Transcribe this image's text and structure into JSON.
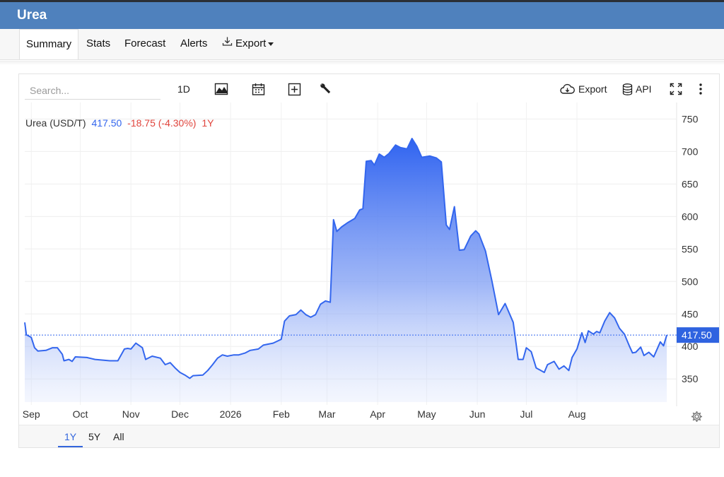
{
  "app": {
    "title": "Urea"
  },
  "tabs": [
    {
      "label": "Summary"
    },
    {
      "label": "Stats"
    },
    {
      "label": "Forecast"
    },
    {
      "label": "Alerts"
    },
    {
      "label": "Export"
    }
  ],
  "toolbar": {
    "search_placeholder": "Search...",
    "interval_label": "1D",
    "export_label": "Export",
    "api_label": "API"
  },
  "icons": [
    "chart-type-icon",
    "calendar-icon",
    "add-compare-icon",
    "wrench-icon",
    "cloud-download-icon",
    "database-icon",
    "fullscreen-icon",
    "more-vertical-icon",
    "settings-gear-icon",
    "download-icon"
  ],
  "colors": {
    "header": "#4f81bd",
    "line": "#3366ee",
    "negative": "#e0443c",
    "price_tag": "#2f63e0"
  },
  "legend": {
    "name": "Urea (USD/T)",
    "price": "417.50",
    "change": "-18.75 (-4.30%)",
    "period": "1Y"
  },
  "ranges": [
    {
      "label": "1Y",
      "active": true
    },
    {
      "label": "5Y",
      "active": false
    },
    {
      "label": "All",
      "active": false
    }
  ],
  "chart_data": {
    "type": "area",
    "title": "",
    "xlabel": "",
    "ylabel": "",
    "series": [
      {
        "name": "Urea (USD/T)",
        "points": [
          [
            "2025-08-28",
            437
          ],
          [
            "2025-08-29",
            418
          ],
          [
            "2025-09-01",
            414
          ],
          [
            "2025-09-03",
            398
          ],
          [
            "2025-09-05",
            393
          ],
          [
            "2025-09-10",
            394
          ],
          [
            "2025-09-14",
            398
          ],
          [
            "2025-09-17",
            398
          ],
          [
            "2025-09-20",
            388
          ],
          [
            "2025-09-21",
            378
          ],
          [
            "2025-09-24",
            380
          ],
          [
            "2025-09-26",
            377
          ],
          [
            "2025-09-28",
            384
          ],
          [
            "2025-10-05",
            383
          ],
          [
            "2025-10-10",
            380
          ],
          [
            "2025-10-19",
            378
          ],
          [
            "2025-10-24",
            378
          ],
          [
            "2025-10-28",
            396
          ],
          [
            "2025-10-30",
            397
          ],
          [
            "2025-11-01",
            396
          ],
          [
            "2025-11-04",
            405
          ],
          [
            "2025-11-08",
            398
          ],
          [
            "2025-11-10",
            380
          ],
          [
            "2025-11-14",
            385
          ],
          [
            "2025-11-19",
            382
          ],
          [
            "2025-11-22",
            372
          ],
          [
            "2025-11-25",
            375
          ],
          [
            "2025-11-28",
            367
          ],
          [
            "2025-12-01",
            360
          ],
          [
            "2025-12-04",
            356
          ],
          [
            "2025-12-07",
            351
          ],
          [
            "2025-12-09",
            355
          ],
          [
            "2025-12-15",
            356
          ],
          [
            "2025-12-18",
            363
          ],
          [
            "2025-12-21",
            372
          ],
          [
            "2025-12-24",
            382
          ],
          [
            "2025-12-27",
            387
          ],
          [
            "2025-12-30",
            385
          ],
          [
            "2026-01-03",
            387
          ],
          [
            "2026-01-06",
            387
          ],
          [
            "2026-01-10",
            390
          ],
          [
            "2026-01-13",
            394
          ],
          [
            "2026-01-18",
            396
          ],
          [
            "2026-01-21",
            402
          ],
          [
            "2026-01-27",
            405
          ],
          [
            "2026-02-01",
            411
          ],
          [
            "2026-02-03",
            439
          ],
          [
            "2026-02-06",
            447
          ],
          [
            "2026-02-10",
            449
          ],
          [
            "2026-02-13",
            456
          ],
          [
            "2026-02-16",
            449
          ],
          [
            "2026-02-19",
            445
          ],
          [
            "2026-02-22",
            449
          ],
          [
            "2026-02-25",
            465
          ],
          [
            "2026-02-28",
            470
          ],
          [
            "2026-03-03",
            468
          ],
          [
            "2026-03-05",
            595
          ],
          [
            "2026-03-07",
            577
          ],
          [
            "2026-03-10",
            584
          ],
          [
            "2026-03-14",
            591
          ],
          [
            "2026-03-18",
            597
          ],
          [
            "2026-03-21",
            610
          ],
          [
            "2026-03-23",
            612
          ],
          [
            "2026-03-25",
            685
          ],
          [
            "2026-03-28",
            686
          ],
          [
            "2026-03-30",
            679
          ],
          [
            "2026-04-02",
            696
          ],
          [
            "2026-04-05",
            691
          ],
          [
            "2026-04-08",
            697
          ],
          [
            "2026-04-12",
            710
          ],
          [
            "2026-04-15",
            706
          ],
          [
            "2026-04-19",
            704
          ],
          [
            "2026-04-22",
            720
          ],
          [
            "2026-04-25",
            708
          ],
          [
            "2026-04-28",
            691
          ],
          [
            "2026-05-03",
            693
          ],
          [
            "2026-05-07",
            690
          ],
          [
            "2026-05-10",
            684
          ],
          [
            "2026-05-13",
            587
          ],
          [
            "2026-05-15",
            580
          ],
          [
            "2026-05-18",
            615
          ],
          [
            "2026-05-21",
            548
          ],
          [
            "2026-05-24",
            549
          ],
          [
            "2026-05-28",
            570
          ],
          [
            "2026-05-31",
            578
          ],
          [
            "2026-06-02",
            573
          ],
          [
            "2026-06-06",
            547
          ],
          [
            "2026-06-10",
            500
          ],
          [
            "2026-06-14",
            449
          ],
          [
            "2026-06-18",
            466
          ],
          [
            "2026-06-23",
            437
          ],
          [
            "2026-06-26",
            380
          ],
          [
            "2026-06-29",
            380
          ],
          [
            "2026-07-01",
            398
          ],
          [
            "2026-07-04",
            392
          ],
          [
            "2026-07-07",
            367
          ],
          [
            "2026-07-12",
            360
          ],
          [
            "2026-07-14",
            372
          ],
          [
            "2026-07-18",
            377
          ],
          [
            "2026-07-21",
            365
          ],
          [
            "2026-07-24",
            370
          ],
          [
            "2026-07-27",
            363
          ],
          [
            "2026-07-29",
            383
          ],
          [
            "2026-08-01",
            396
          ],
          [
            "2026-08-04",
            421
          ],
          [
            "2026-08-06",
            406
          ],
          [
            "2026-08-08",
            424
          ],
          [
            "2026-08-11",
            419
          ],
          [
            "2026-08-13",
            423
          ],
          [
            "2026-08-15",
            421
          ],
          [
            "2026-08-18",
            439
          ],
          [
            "2026-08-21",
            452
          ],
          [
            "2026-08-24",
            444
          ],
          [
            "2026-08-27",
            428
          ],
          [
            "2026-08-30",
            419
          ],
          [
            "2026-09-02",
            401
          ],
          [
            "2026-09-04",
            390
          ],
          [
            "2026-09-06",
            391
          ],
          [
            "2026-09-09",
            399
          ],
          [
            "2026-09-11",
            386
          ],
          [
            "2026-09-14",
            391
          ],
          [
            "2026-09-17",
            384
          ],
          [
            "2026-09-21",
            407
          ],
          [
            "2026-09-23",
            401
          ],
          [
            "2026-09-25",
            417.5
          ]
        ]
      }
    ],
    "x_ticks": [
      {
        "label": "Sep",
        "date": "2025-09-01"
      },
      {
        "label": "Oct",
        "date": "2025-10-01"
      },
      {
        "label": "Nov",
        "date": "2025-11-01"
      },
      {
        "label": "Dec",
        "date": "2025-12-01"
      },
      {
        "label": "2026",
        "date": "2026-01-01"
      },
      {
        "label": "Feb",
        "date": "2026-02-01"
      },
      {
        "label": "Mar",
        "date": "2026-03-01"
      },
      {
        "label": "Apr",
        "date": "2026-04-01"
      },
      {
        "label": "May",
        "date": "2026-05-01"
      },
      {
        "label": "Jun",
        "date": "2026-06-01"
      },
      {
        "label": "Jul",
        "date": "2026-07-01"
      },
      {
        "label": "Aug",
        "date": "2026-08-01"
      }
    ],
    "y_ticks": [
      350,
      400,
      450,
      500,
      550,
      600,
      650,
      700,
      750
    ],
    "ylim": [
      310,
      770
    ],
    "xlim": [
      "2025-08-28",
      "2026-10-01"
    ],
    "last_value": 417.5,
    "last_value_label": "417.50",
    "grid": true,
    "y_axis_side": "right"
  }
}
